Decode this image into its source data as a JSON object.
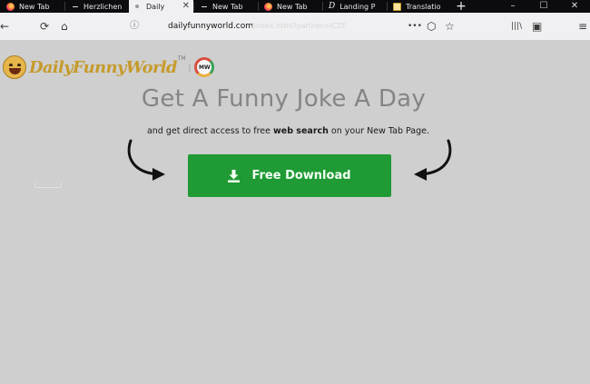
{
  "browser": {
    "tabs": [
      {
        "label": "New Tab",
        "icon": "firefox-icon",
        "active": false
      },
      {
        "label": "Herzlichen",
        "icon": "tab-icon",
        "active": false
      },
      {
        "label": "Daily",
        "icon": "loading-icon",
        "active": true
      },
      {
        "label": "New Tab",
        "icon": "tab-icon",
        "active": false
      },
      {
        "label": "New Tab",
        "icon": "firefox-icon",
        "active": false
      },
      {
        "label": "Landing P",
        "icon": "ld-icon",
        "active": false
      },
      {
        "label": "Translatio",
        "icon": "translate-icon",
        "active": false
      }
    ],
    "new_tab_label": "+",
    "window_controls": {
      "minimize": "–",
      "maximize": "☐",
      "close": "✕"
    },
    "nav": {
      "back": "←",
      "reload": "⟳",
      "home": "⌂",
      "url_prefix": "ⓘ",
      "url_host": "dailyfunnyworld.com",
      "url_rest": "/index.html?partner=ICZF",
      "more": "•••",
      "pocket": "⬡",
      "star": "☆",
      "library": "|||\\",
      "sidebar": "▣",
      "menu": "≡"
    }
  },
  "page": {
    "logo_text": "DailyFunnyWorld",
    "logo_tm": "TM",
    "logo_sep": "|",
    "mw_badge": "MW",
    "headline": "Get A Funny Joke A Day",
    "subline_pre": "and get direct access to free ",
    "subline_bold": "web search",
    "subline_post": " on your New Tab Page.",
    "cta_label": "Free Download",
    "colors": {
      "cta": "#1f9a35",
      "page_bg": "#cfcfcf",
      "headline": "#858585"
    }
  }
}
